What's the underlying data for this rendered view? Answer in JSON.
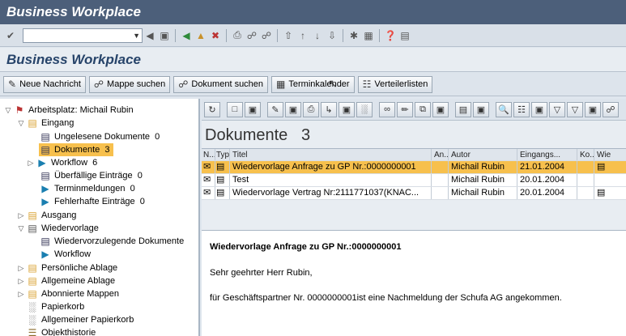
{
  "window": {
    "title": "Business Workplace"
  },
  "app": {
    "title": "Business Workplace"
  },
  "toolbar": {
    "buttons": [
      {
        "label": "Neue Nachricht",
        "icon": "new-message-icon"
      },
      {
        "label": "Mappe suchen",
        "icon": "binoculars-icon"
      },
      {
        "label": "Dokument suchen",
        "icon": "binoculars-icon"
      },
      {
        "label": "Terminkalender",
        "icon": "calendar-icon"
      },
      {
        "label": "Verteilerlisten",
        "icon": "distribution-list-icon"
      }
    ]
  },
  "tree": {
    "root": "Arbeitsplatz: Michail Rubin",
    "inbox": "Eingang",
    "unread": "Ungelesene Dokumente",
    "unread_count": "0",
    "documents": "Dokumente",
    "documents_count": "3",
    "workflow": "Workflow",
    "workflow_count": "6",
    "overdue": "Überfällige Einträge",
    "overdue_count": "0",
    "appointments": "Terminmeldungen",
    "appointments_count": "0",
    "errors": "Fehlerhafte Einträge",
    "errors_count": "0",
    "outbox": "Ausgang",
    "resubmission": "Wiedervorlage",
    "resub_docs": "Wiedervorzulegende Dokumente",
    "resub_workflow": "Workflow",
    "personal": "Persönliche Ablage",
    "general": "Allgemeine Ablage",
    "subscribed": "Abonnierte Mappen",
    "trash": "Papierkorb",
    "general_trash": "Allgemeiner Papierkorb",
    "history": "Objekthistorie"
  },
  "list": {
    "title": "Dokumente",
    "count": "3",
    "columns": [
      "N...",
      "Typ",
      "Titel",
      "An...",
      "Autor",
      "Eingangs...",
      "Ko...",
      "Wie"
    ],
    "rows": [
      {
        "title": "Wiedervorlage Anfrage zu GP Nr.:0000000001",
        "author": "Michail Rubin",
        "date": "21.01.2004"
      },
      {
        "title": "Test",
        "author": "Michail Rubin",
        "date": "20.01.2004"
      },
      {
        "title": "Wiedervorlage Vertrag Nr:2111771037(KNAC...",
        "author": "Michail Rubin",
        "date": "20.01.2004"
      }
    ]
  },
  "preview": {
    "subject": "Wiedervorlage Anfrage zu GP Nr.:0000000001",
    "greeting": "Sehr geehrter Herr Rubin,",
    "body": "für Geschäftspartner Nr. 0000000001ist eine Nachmeldung der Schufa AG angekommen."
  },
  "colors": {
    "selection": "#f7c04d",
    "title_bar": "#4c5f7a",
    "app_title": "#27446a"
  }
}
